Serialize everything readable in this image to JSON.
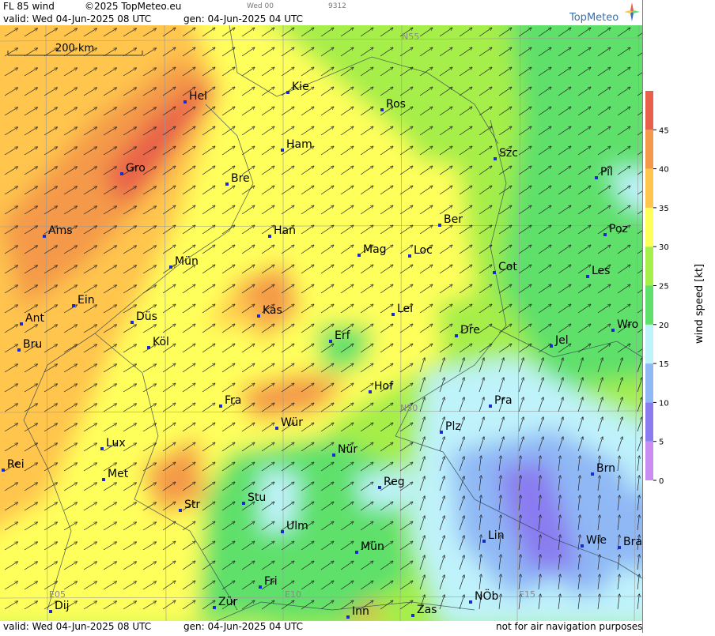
{
  "header": {
    "product": "FL 85 wind",
    "copyright": "©2025 TopMeteo.eu",
    "run_short": "Wed 00",
    "code": "9312",
    "valid": "valid:  Wed  04-Jun-2025  08 UTC",
    "generated": "gen: 04-Jun-2025 04 UTC"
  },
  "footer": {
    "valid": "valid:  Wed  04-Jun-2025  08 UTC",
    "generated": "gen: 04-Jun-2025 04 UTC",
    "disclaimer": "not for air navigation purposes"
  },
  "brand": {
    "logo_text": "TopMeteo"
  },
  "scale_bar": {
    "label": "200 km"
  },
  "legend": {
    "title": "wind speed [kt]",
    "ticks": [
      "0",
      "5",
      "10",
      "15",
      "20",
      "25",
      "30",
      "35",
      "40",
      "45"
    ],
    "colors": [
      "#c98cf0",
      "#8a7cf0",
      "#8fb8f5",
      "#bff3fb",
      "#5ee06a",
      "#a6ee4a",
      "#ffff5c",
      "#ffc54d",
      "#f4994a",
      "#e8604a"
    ]
  },
  "grid_labels": {
    "n55": "N55",
    "n50": "N50",
    "e05": "E05",
    "e10": "E10",
    "e15": "E15"
  },
  "cities": [
    {
      "name": "Kie"
    },
    {
      "name": "Hel"
    },
    {
      "name": "Ros"
    },
    {
      "name": "Ham"
    },
    {
      "name": "Szc"
    },
    {
      "name": "Gro"
    },
    {
      "name": "Bre"
    },
    {
      "name": "Pil"
    },
    {
      "name": "Ber"
    },
    {
      "name": "Ams"
    },
    {
      "name": "Han"
    },
    {
      "name": "Poz"
    },
    {
      "name": "Mag"
    },
    {
      "name": "Loc"
    },
    {
      "name": "Mün"
    },
    {
      "name": "Cot"
    },
    {
      "name": "Les"
    },
    {
      "name": "Ein"
    },
    {
      "name": "Kas"
    },
    {
      "name": "Lei"
    },
    {
      "name": "Ant"
    },
    {
      "name": "Düs"
    },
    {
      "name": "Dre"
    },
    {
      "name": "Wro"
    },
    {
      "name": "Erf"
    },
    {
      "name": "Bru"
    },
    {
      "name": "Köl"
    },
    {
      "name": "Jel"
    },
    {
      "name": "Hof"
    },
    {
      "name": "Fra"
    },
    {
      "name": "Pra"
    },
    {
      "name": "Wür"
    },
    {
      "name": "N50"
    },
    {
      "name": "Lux"
    },
    {
      "name": "Plz"
    },
    {
      "name": "Nür"
    },
    {
      "name": "Rei"
    },
    {
      "name": "Met"
    },
    {
      "name": "Brn"
    },
    {
      "name": "Reg"
    },
    {
      "name": "Stu"
    },
    {
      "name": "Str"
    },
    {
      "name": "Ulm"
    },
    {
      "name": "Lin"
    },
    {
      "name": "Wie"
    },
    {
      "name": "Bra"
    },
    {
      "name": "Mün"
    },
    {
      "name": "Fri"
    },
    {
      "name": "NÖb"
    },
    {
      "name": "Dij"
    },
    {
      "name": "Zür"
    },
    {
      "name": "Inn"
    },
    {
      "name": "Zas"
    }
  ]
}
